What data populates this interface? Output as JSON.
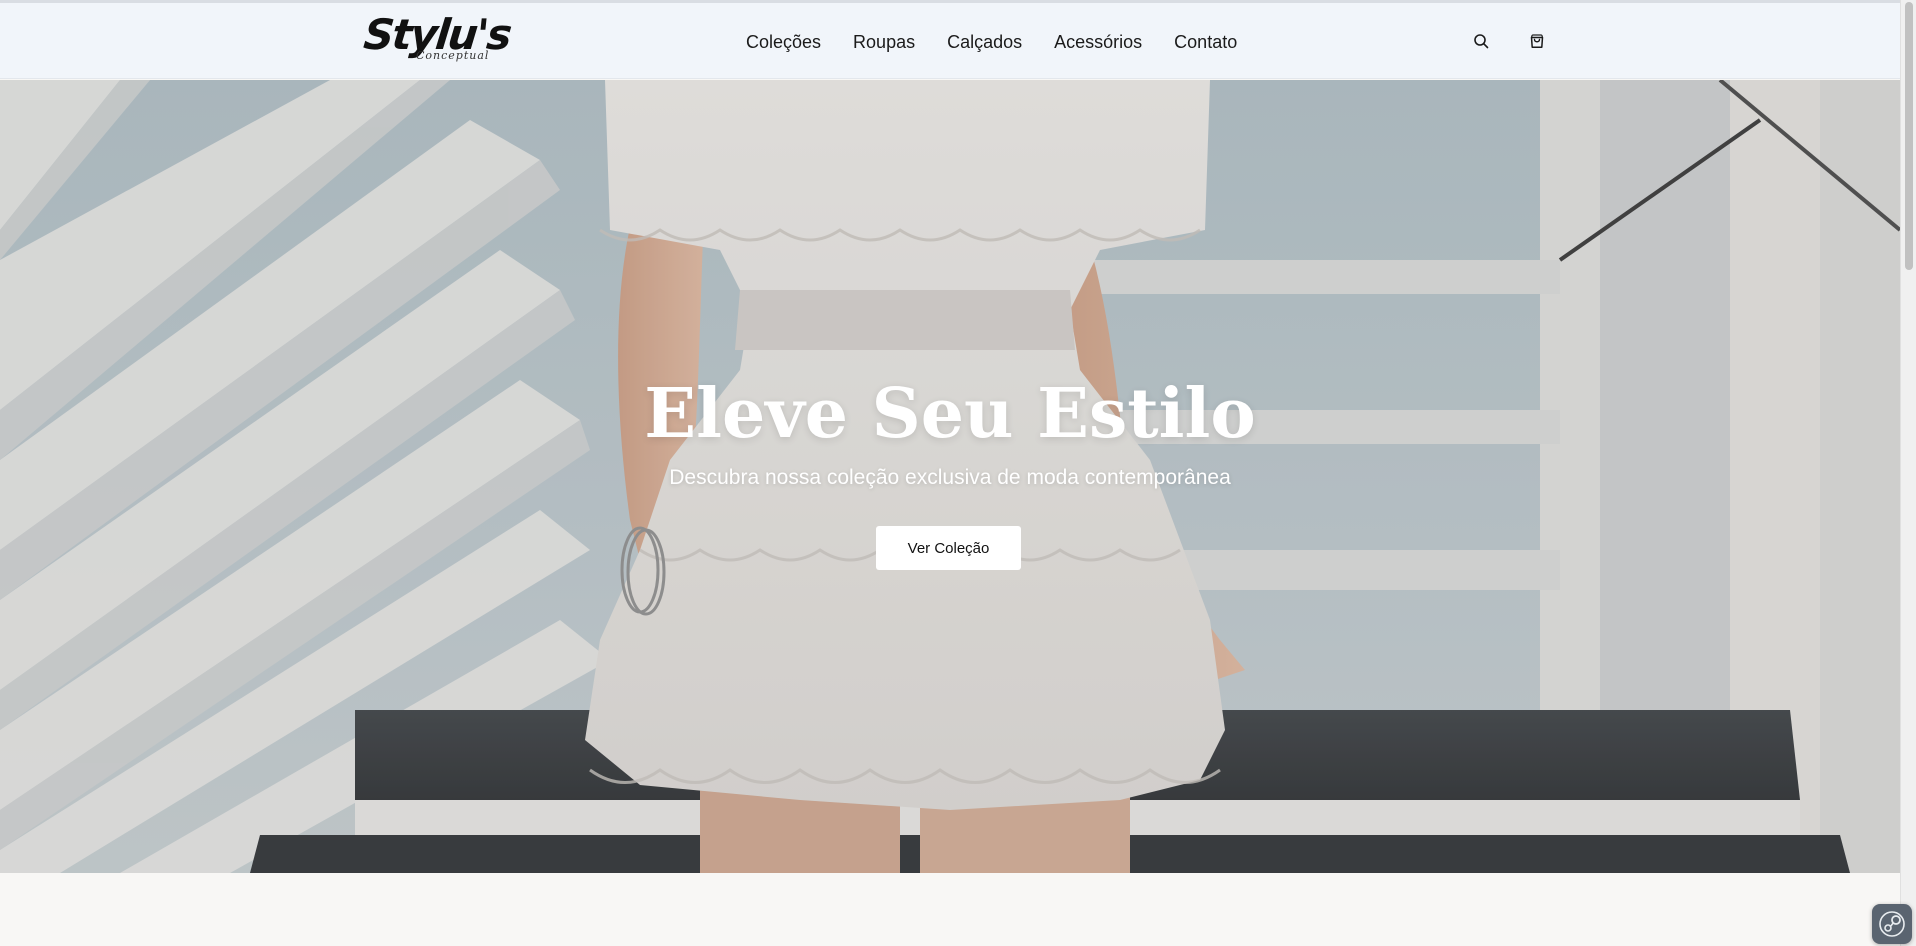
{
  "brand": {
    "logo_text": "Stylu's",
    "logo_script": "Conceptual"
  },
  "nav": {
    "items": [
      {
        "label": "Coleções"
      },
      {
        "label": "Roupas"
      },
      {
        "label": "Calçados"
      },
      {
        "label": "Acessórios"
      },
      {
        "label": "Contato"
      }
    ]
  },
  "header_actions": {
    "search_icon": "search-icon",
    "bag_icon": "shopping-bag-icon"
  },
  "hero": {
    "title": "Eleve Seu Estilo",
    "subtitle": "Descubra nossa coleção exclusiva de moda contemporânea",
    "cta_label": "Ver Coleção",
    "image_icon": "hero-photo"
  },
  "widget": {
    "icon": "steam-icon"
  },
  "colors": {
    "header_bg": "#f1f5fa",
    "page_bg": "#f8f7f5",
    "cta_bg": "#ffffff",
    "text_dark": "#111111"
  }
}
